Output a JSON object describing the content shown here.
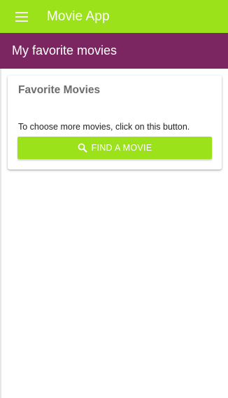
{
  "appbar": {
    "title": "Movie App",
    "menu_icon": "hamburger-menu-icon",
    "background": "#9be21b"
  },
  "subheader": {
    "title": "My favorite movies",
    "background": "#7b2660"
  },
  "card": {
    "title": "Favorite Movies",
    "text": "To choose more movies, click on this button.",
    "button": {
      "label": "FIND A MOVIE",
      "icon": "search-icon",
      "background": "#9be21b"
    }
  }
}
